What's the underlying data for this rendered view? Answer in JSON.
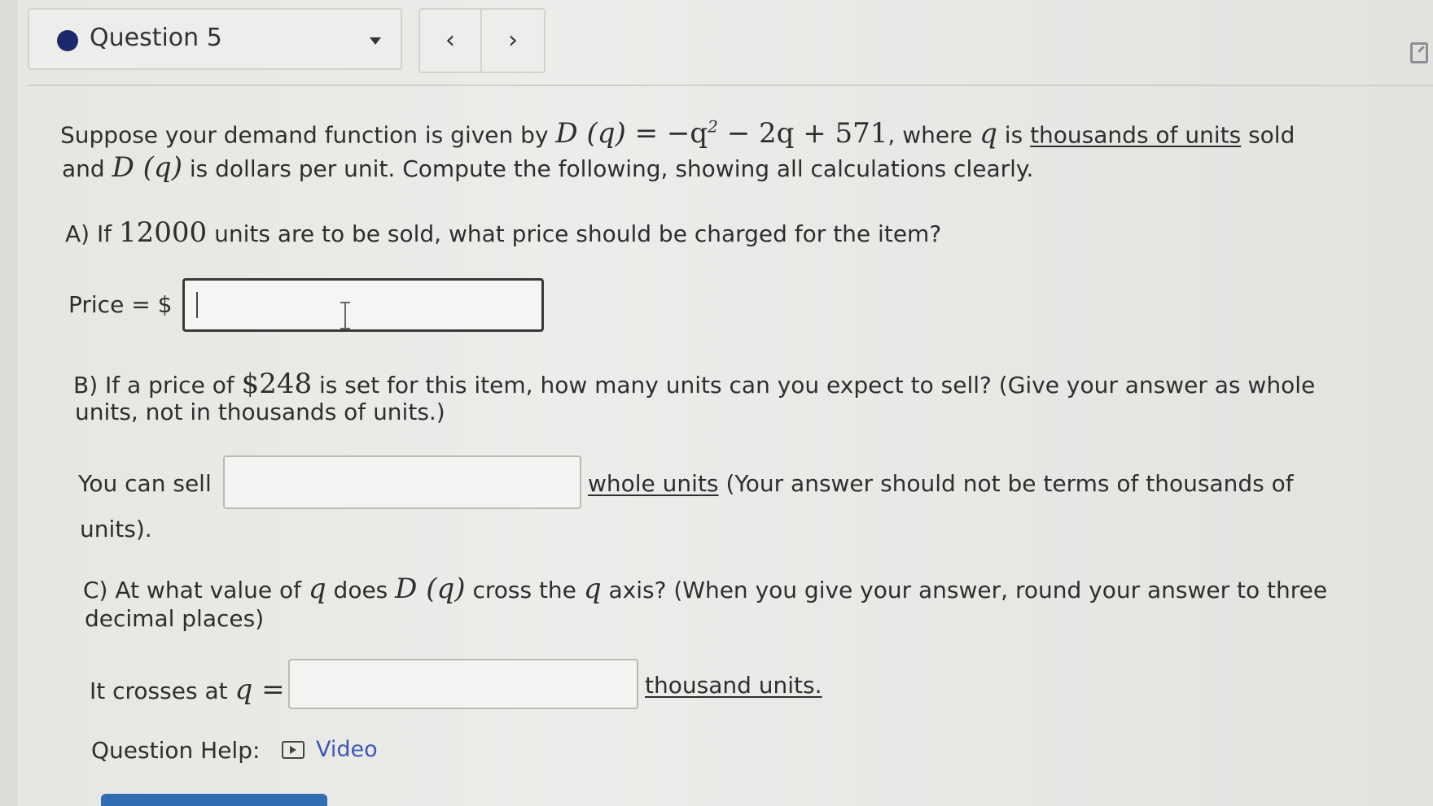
{
  "header": {
    "question_label": "Question 5",
    "prev_glyph": "‹",
    "next_glyph": "›"
  },
  "problem": {
    "intro_1": "Suppose your demand function is given by",
    "func_lhs": "D (q)",
    "func_eq": "= −q",
    "func_exp": "2",
    "func_rest": "− 2q + 571",
    "intro_2": ", where",
    "q_var": "q",
    "intro_3": "is",
    "units_underlined": "thousands of units",
    "intro_4": "sold",
    "line2_a": "and",
    "line2_func": "D (q)",
    "line2_b": "is dollars per unit. Compute the following, showing all calculations clearly."
  },
  "part_a": {
    "q_pre": "A) If",
    "q_num": "12000",
    "q_post": "units are to be sold, what price should be charged for the item?",
    "label": "Price = $",
    "value": ""
  },
  "part_b": {
    "q_pre": "B) If a price of",
    "q_num": "$248",
    "q_post": "is set for this item, how many units can you expect to sell? (Give your answer as whole",
    "q_line2": "units, not in thousands of units.)",
    "label": "You can sell",
    "value": "",
    "after_underlined": "whole units",
    "after_rest": "(Your answer should not be terms of thousands of",
    "after_line2": "units)."
  },
  "part_c": {
    "q_pre": "C) At what value of",
    "q_var": "q",
    "q_mid": "does",
    "q_func": "D (q)",
    "q_mid2": "cross the",
    "q_var2": "q",
    "q_post": "axis? (When you give your answer, round your answer to three",
    "q_line2": "decimal places)",
    "label_pre": "It crosses at",
    "label_math": "q =",
    "value": "",
    "after": "thousand units."
  },
  "help": {
    "label": "Question Help:",
    "video_label": "Video"
  }
}
